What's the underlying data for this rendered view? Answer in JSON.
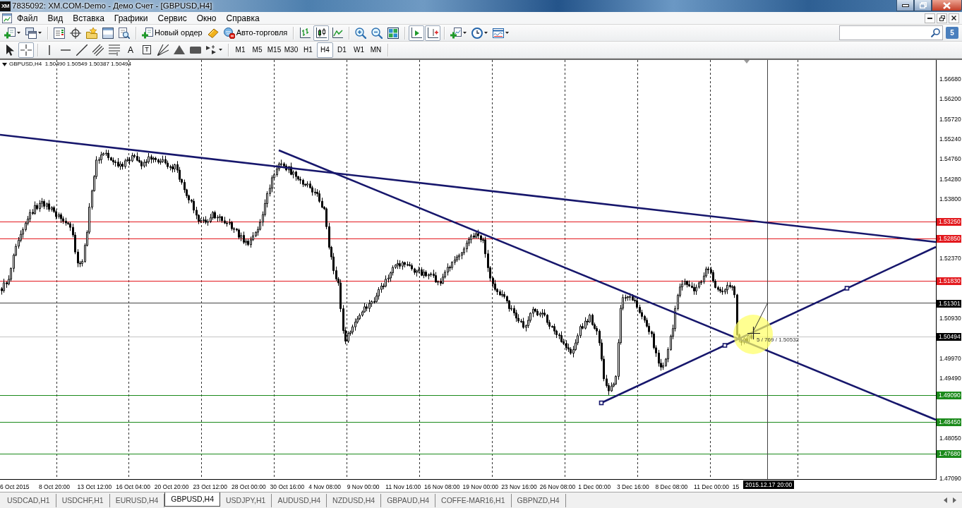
{
  "window": {
    "icon": "XM",
    "title": "7835092: XM.COM-Demo - Демо Счет - [GBPUSD,H4]"
  },
  "menu": [
    "Файл",
    "Вид",
    "Вставка",
    "Графики",
    "Сервис",
    "Окно",
    "Справка"
  ],
  "toolbar": [
    {
      "kind": "newchart",
      "on": false
    },
    {
      "kind": "profiles",
      "on": false
    },
    {
      "kind": "separator"
    },
    {
      "kind": "marketwatch",
      "on": false
    },
    {
      "kind": "datawindow",
      "on": false
    },
    {
      "kind": "navigator",
      "on": false
    },
    {
      "kind": "terminal",
      "on": false
    },
    {
      "kind": "tester",
      "on": false
    },
    {
      "kind": "separator"
    },
    {
      "kind": "order",
      "label": "Новый ордер",
      "on": false
    },
    {
      "kind": "experts",
      "on": false
    },
    {
      "kind": "autotrading",
      "label": "Авто-торговля",
      "on": false
    },
    {
      "kind": "separator"
    },
    {
      "kind": "barchart",
      "on": false
    },
    {
      "kind": "candles",
      "on": true
    },
    {
      "kind": "linechart",
      "on": false
    },
    {
      "kind": "separator"
    },
    {
      "kind": "zoomin",
      "on": false
    },
    {
      "kind": "zoomout",
      "on": false
    },
    {
      "kind": "tile",
      "on": false
    },
    {
      "kind": "separator"
    },
    {
      "kind": "autoscroll",
      "on": true
    },
    {
      "kind": "shift",
      "on": true
    },
    {
      "kind": "separator"
    },
    {
      "kind": "indicators",
      "on": false
    },
    {
      "kind": "periods",
      "on": false
    },
    {
      "kind": "templates",
      "on": false
    }
  ],
  "messages": "5",
  "drawing_tools": [
    {
      "kind": "cursor",
      "on": false
    },
    {
      "kind": "crosshair",
      "on": true
    },
    {
      "kind": "separator"
    },
    {
      "kind": "vline",
      "on": false
    },
    {
      "kind": "hline",
      "on": false
    },
    {
      "kind": "trendline",
      "on": false
    },
    {
      "kind": "channel",
      "on": false
    },
    {
      "kind": "fibo",
      "on": false
    },
    {
      "kind": "text",
      "label": "A",
      "on": false
    },
    {
      "kind": "label",
      "label": "T",
      "on": false
    },
    {
      "kind": "gann",
      "on": false
    },
    {
      "kind": "triangle",
      "on": false
    },
    {
      "kind": "rectangle",
      "on": false
    },
    {
      "kind": "arrows",
      "on": false
    }
  ],
  "timeframes": [
    {
      "label": "M1",
      "selected": false
    },
    {
      "label": "M5",
      "selected": false
    },
    {
      "label": "M15",
      "selected": false
    },
    {
      "label": "M30",
      "selected": false
    },
    {
      "label": "H1",
      "selected": false
    },
    {
      "label": "H4",
      "selected": true
    },
    {
      "label": "D1",
      "selected": false
    },
    {
      "label": "W1",
      "selected": false
    },
    {
      "label": "MN",
      "selected": false
    }
  ],
  "chart": {
    "info": "GBPUSD,H4  1.50490 1.50549 1.50387 1.50494",
    "price_labels": [
      "1.56680",
      "1.56200",
      "1.55720",
      "1.55240",
      "1.54760",
      "1.54280",
      "1.53800",
      "1.52370",
      "1.50930",
      "1.49970",
      "1.49490",
      "1.48050",
      "1.47090"
    ],
    "levels": [
      {
        "label": "1.53250",
        "color": "#e3191e"
      },
      {
        "label": "1.52850",
        "color": "#e3191e"
      },
      {
        "label": "1.51830",
        "color": "#e3191e"
      },
      {
        "label": "1.49090",
        "color": "#1b8a1b"
      },
      {
        "label": "1.48450",
        "color": "#1b8a1b"
      },
      {
        "label": "1.47680",
        "color": "#1b8a1b"
      }
    ],
    "bid_label": "1.50494",
    "crosshair": {
      "price": "1.51301",
      "time": "2015.12.17 20:00",
      "readout": "5 / 769 / 1.50532"
    },
    "time_labels": [
      "6 Oct 2015",
      "8 Oct 20:00",
      "13 Oct 12:00",
      "16 Oct 04:00",
      "20 Oct 20:00",
      "23 Oct 12:00",
      "28 Oct 00:00",
      "30 Oct 16:00",
      "4 Nov 08:00",
      "9 Nov 00:00",
      "11 Nov 16:00",
      "16 Nov 08:00",
      "19 Nov 00:00",
      "23 Nov 16:00",
      "26 Nov 08:00",
      "1 Dec 00:00",
      "3 Dec 16:00",
      "8 Dec 08:00",
      "11 Dec 00:00",
      "15"
    ]
  },
  "tabs": [
    {
      "label": "USDCAD,H1",
      "selected": false
    },
    {
      "label": "USDCHF,H1",
      "selected": false
    },
    {
      "label": "EURUSD,H4",
      "selected": false
    },
    {
      "label": "GBPUSD,H4",
      "selected": true
    },
    {
      "label": "USDJPY,H1",
      "selected": false
    },
    {
      "label": "AUDUSD,H4",
      "selected": false
    },
    {
      "label": "NZDUSD,H4",
      "selected": false
    },
    {
      "label": "GBPAUD,H4",
      "selected": false
    },
    {
      "label": "COFFE-MAR16,H1",
      "selected": false
    },
    {
      "label": "GBPNZD,H4",
      "selected": false
    }
  ]
}
